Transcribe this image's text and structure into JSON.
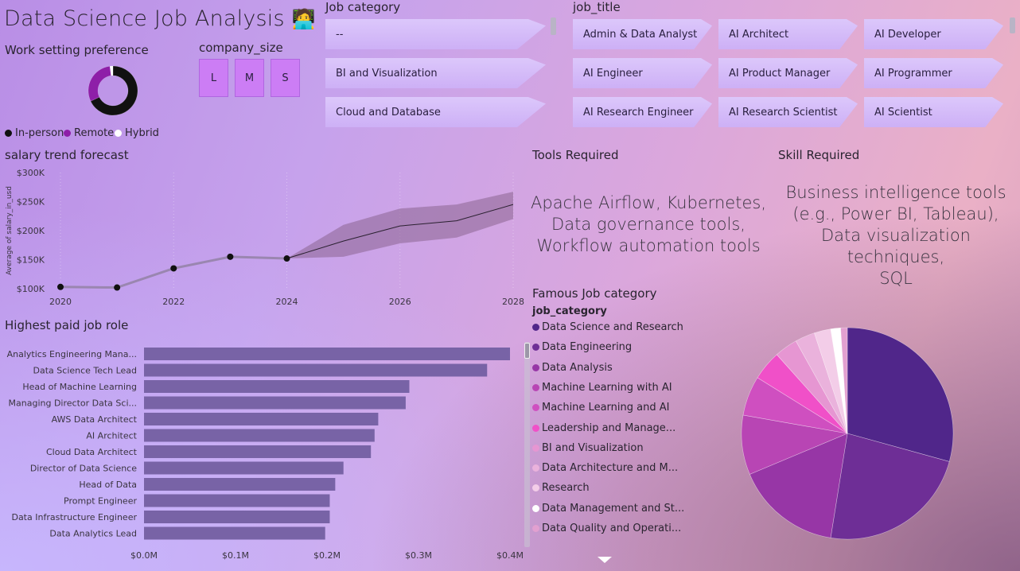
{
  "title": "Data Science Job Analysis",
  "title_emoji": "🧑‍💻",
  "work_setting": {
    "title": "Work setting preference",
    "legend": [
      {
        "label": "In-person",
        "color": "#111111"
      },
      {
        "label": "Remote",
        "color": "#8e1fa8"
      },
      {
        "label": "Hybrid",
        "color": "#ffffff"
      }
    ]
  },
  "company_size": {
    "title": "company_size",
    "options": [
      "L",
      "M",
      "S"
    ]
  },
  "job_category_slicer": {
    "title": "Job category",
    "options": [
      "--",
      "BI and Visualization",
      "Cloud and Database"
    ]
  },
  "job_title_slicer": {
    "title": "job_title",
    "options": [
      "Admin & Data Analyst",
      "AI Architect",
      "AI Developer",
      "AI Engineer",
      "AI Product Manager",
      "AI Programmer",
      "AI Research Engineer",
      "AI Research Scientist",
      "AI Scientist"
    ]
  },
  "salary_trend": {
    "title": "salary trend forecast"
  },
  "tools": {
    "title": "Tools Required",
    "text": [
      "Apache Airflow, Kubernetes,",
      "Data governance tools,",
      "Workflow automation tools"
    ]
  },
  "skills": {
    "title": "Skill Required",
    "text": [
      "Business intelligence tools",
      "(e.g., Power BI, Tableau),",
      "Data visualization techniques,",
      "SQL"
    ]
  },
  "highest_paid": {
    "title": "Highest paid job role"
  },
  "famous_category": {
    "title": "Famous Job category",
    "legend_title": "job_category"
  },
  "chart_data": [
    {
      "type": "donut",
      "name": "Work setting preference",
      "categories": [
        "In-person",
        "Remote",
        "Hybrid"
      ],
      "values": [
        68,
        30,
        2
      ],
      "colors": [
        "#111111",
        "#8e1fa8",
        "#ffffff"
      ]
    },
    {
      "type": "line",
      "title": "salary trend forecast",
      "ylabel": "Average of salary_in_usd",
      "xlabel": "",
      "x": [
        2020,
        2021,
        2022,
        2023,
        2024
      ],
      "y": [
        103000,
        102000,
        135000,
        155000,
        152000
      ],
      "forecast_x": [
        2024,
        2025,
        2026,
        2027,
        2028
      ],
      "forecast_y": [
        152000,
        182000,
        208000,
        217000,
        245000
      ],
      "forecast_upper": [
        152000,
        210000,
        238000,
        245000,
        267000
      ],
      "forecast_lower": [
        152000,
        155000,
        178000,
        188000,
        220000
      ],
      "xticks": [
        2020,
        2022,
        2024,
        2026,
        2028
      ],
      "yticks": [
        "$100K",
        "$150K",
        "$200K",
        "$250K",
        "$300K"
      ],
      "ylim": [
        100000,
        300000
      ],
      "xlim": [
        2020,
        2028
      ],
      "color": "#5a4a66",
      "band_color": "#8a6590"
    },
    {
      "type": "bar",
      "orientation": "horizontal",
      "title": "Highest paid job role",
      "categories": [
        "Analytics Engineering Mana...",
        "Data Science Tech Lead",
        "Head of Machine Learning",
        "Managing Director Data Sci...",
        "AWS Data Architect",
        "AI Architect",
        "Cloud Data Architect",
        "Director of Data Science",
        "Head of Data",
        "Prompt Engineer",
        "Data Infrastructure Engineer",
        "Data Analytics Lead"
      ],
      "values": [
        0.4,
        0.375,
        0.29,
        0.286,
        0.256,
        0.252,
        0.248,
        0.218,
        0.209,
        0.203,
        0.203,
        0.198
      ],
      "unit": "M",
      "xticks": [
        "$0.0M",
        "$0.1M",
        "$0.2M",
        "$0.3M",
        "$0.4M"
      ],
      "xlim": [
        0,
        0.4
      ],
      "color": "#7863a6"
    },
    {
      "type": "pie",
      "title": "Famous Job category",
      "categories": [
        "Data Science and Research",
        "Data Engineering",
        "Data Analysis",
        "Machine Learning with AI",
        "Machine Learning and AI",
        "Leadership and Manage...",
        "BI and Visualization",
        "Data Architecture and M...",
        "Research",
        "Data Management and St...",
        "Data Quality and Operati..."
      ],
      "values": [
        29,
        23,
        16,
        9,
        6,
        4.5,
        3.5,
        3,
        2.5,
        1.5,
        1
      ],
      "colors": [
        "#50268a",
        "#6e2e96",
        "#9736a6",
        "#b845b4",
        "#cf4fc0",
        "#f050c8",
        "#e696d2",
        "#eab2dc",
        "#f3cde8",
        "#ffffff",
        "#e2a0d0"
      ]
    }
  ]
}
